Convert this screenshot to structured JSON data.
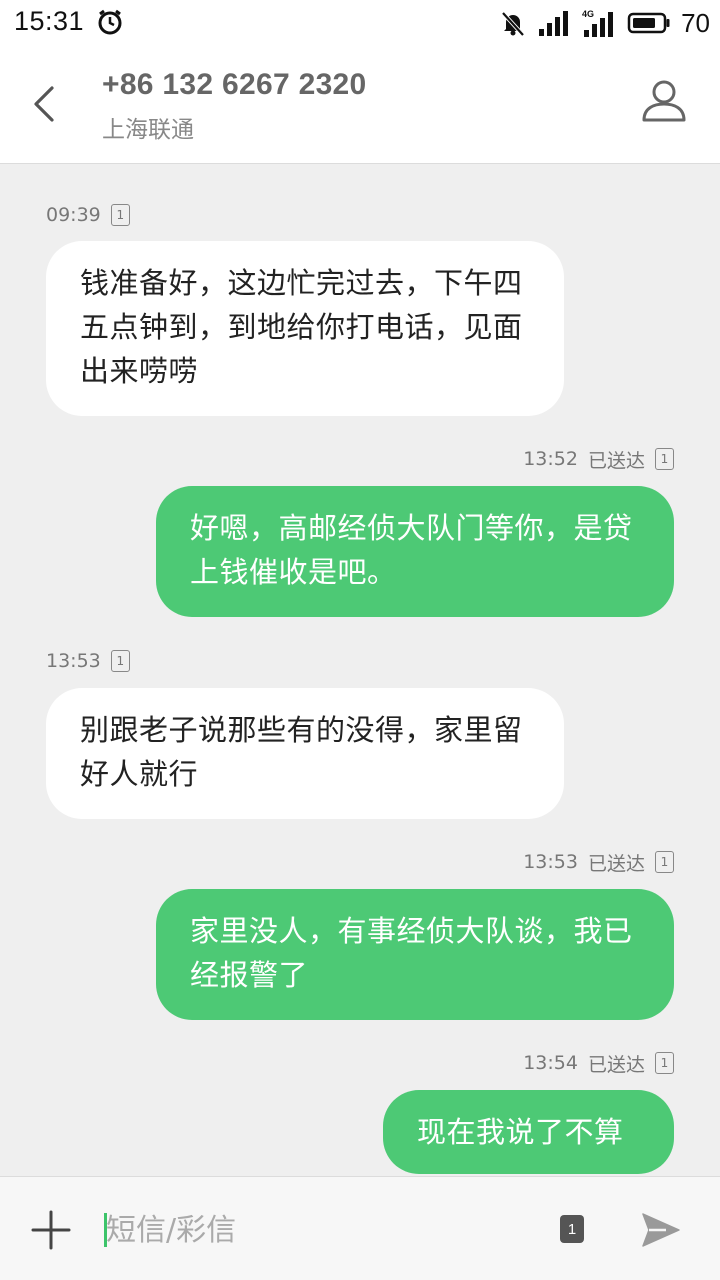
{
  "status_bar": {
    "time": "15:31",
    "battery": "70",
    "network_label": "4G",
    "icons": [
      "alarm-icon",
      "mute-icon",
      "signal-icon",
      "signal-4g-icon",
      "battery-icon"
    ]
  },
  "header": {
    "number": "+86 132 6267 2320",
    "carrier": "上海联通",
    "back_icon": "chevron-left-icon",
    "contact_icon": "person-icon"
  },
  "messages": [
    {
      "dir": "in",
      "time": "09:39",
      "sim": "1",
      "text": "钱准备好，这边忙完过去，下午四五点钟到，到地给你打电话，见面出来唠唠"
    },
    {
      "dir": "out",
      "time": "13:52",
      "status": "已送达",
      "sim": "1",
      "text": "好嗯，高邮经侦大队门等你，是贷上钱催收是吧。"
    },
    {
      "dir": "in",
      "time": "13:53",
      "sim": "1",
      "text": "别跟老子说那些有的没得，家里留好人就行"
    },
    {
      "dir": "out",
      "time": "13:53",
      "status": "已送达",
      "sim": "1",
      "text": "家里没人，有事经侦大队谈，我已经报警了"
    },
    {
      "dir": "out",
      "time": "13:54",
      "status": "已送达",
      "sim": "1",
      "text": "现在我说了不算"
    }
  ],
  "composer": {
    "placeholder": "短信/彩信",
    "sim": "1",
    "add_icon": "plus-icon",
    "send_icon": "send-icon"
  },
  "colors": {
    "outgoing_bubble": "#4dc975",
    "incoming_bubble": "#ffffff",
    "background": "#efefef"
  }
}
